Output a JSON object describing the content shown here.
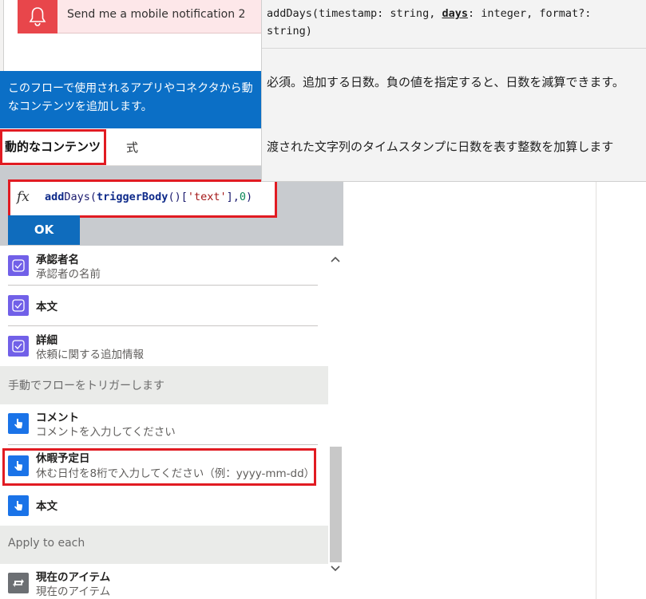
{
  "notification": {
    "label": "Send me a mobile notification 2",
    "icon": "bell-icon",
    "icon_bg": "#e8464b"
  },
  "dynamic_content": {
    "header_line1": "このフローで使用されるアプリやコネクタから動",
    "header_line2": "なコンテンツを追加します。",
    "tab_dynamic": "動的なコンテンツ",
    "tab_expression": "式",
    "expression": {
      "fx": "fx",
      "fn_add": "add",
      "fn_days": "Days(",
      "trigger": "triggerBody",
      "paren": "()[",
      "str": "'text'",
      "after_str": "],",
      "num": "0",
      "close": ")"
    },
    "ok_label": "OK"
  },
  "list": {
    "items_top": [
      {
        "title": "承認者名",
        "subtitle": "承認者の名前",
        "icon": "approval-icon"
      },
      {
        "title": "本文",
        "subtitle": "",
        "icon": "approval-icon"
      },
      {
        "title": "詳細",
        "subtitle": "依頼に関する追加情報",
        "icon": "approval-icon"
      }
    ],
    "section_manual": "手動でフローをトリガーします",
    "items_manual": [
      {
        "title": "コメント",
        "subtitle": "コメントを入力してください",
        "icon": "touch-icon"
      },
      {
        "title": "休暇予定日",
        "subtitle": "休む日付を8桁で入力してください（例：yyyy-mm-dd）",
        "icon": "touch-icon"
      },
      {
        "title": "本文",
        "subtitle": "",
        "icon": "touch-icon"
      }
    ],
    "section_apply": "Apply to each",
    "items_apply": [
      {
        "title": "現在のアイテム",
        "subtitle": "現在のアイテム",
        "icon": "loop-icon"
      }
    ]
  },
  "tooltip": {
    "sig_prefix": "addDays(timestamp: string, ",
    "sig_param": "days",
    "sig_suffix": ": integer, format?: string)",
    "param_desc": "必須。追加する日数。負の値を指定すると、日数を減算できます。",
    "func_desc": "渡された文字列のタイムスタンプに日数を表す整数を加算します"
  },
  "colors": {
    "accent_blue": "#0f6cbd",
    "highlight_red": "#e11b22",
    "approval_purple": "#7160e8",
    "touch_blue": "#1a73e8"
  }
}
